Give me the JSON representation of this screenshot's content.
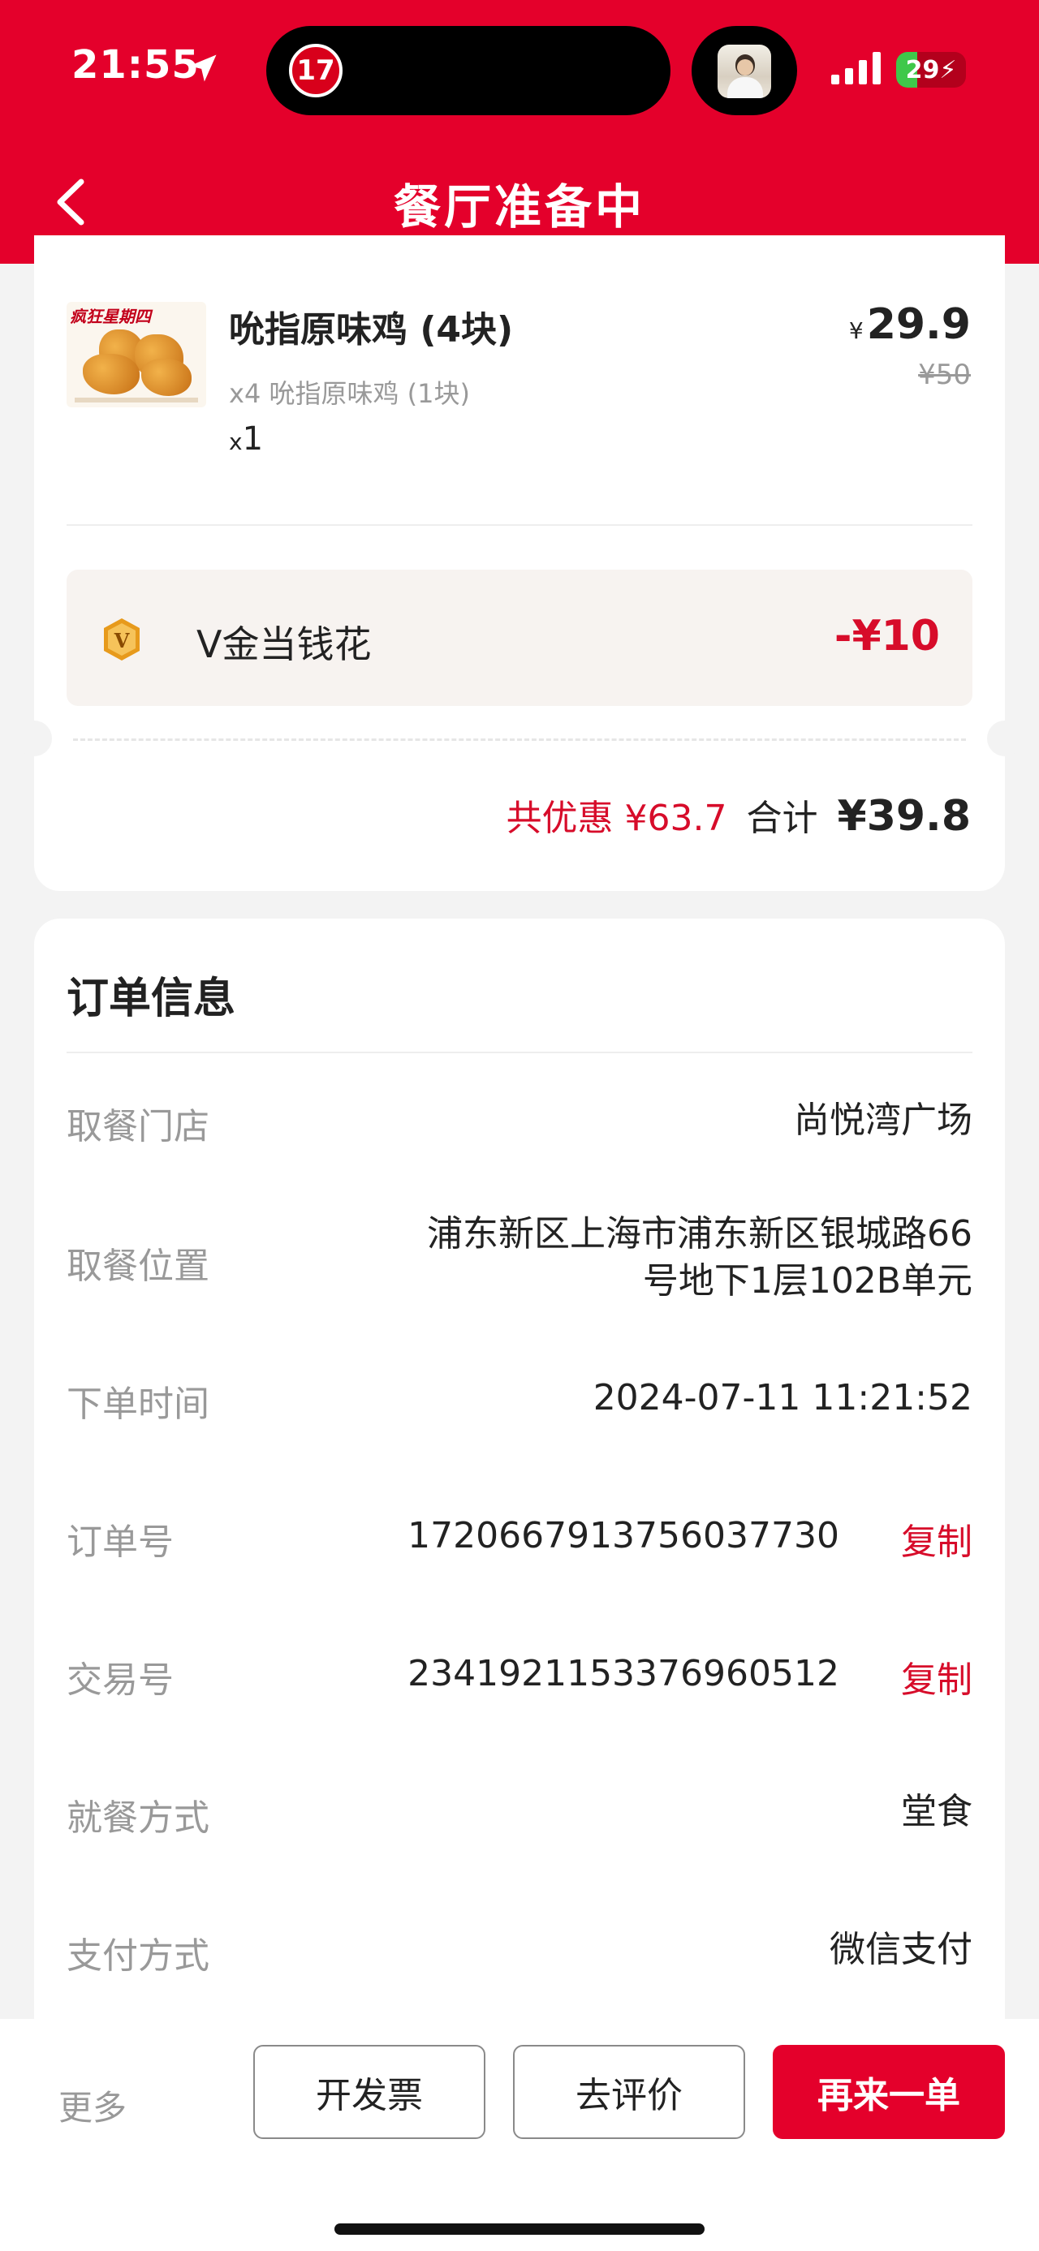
{
  "status_bar": {
    "time": "21:55",
    "timer_badge": "17",
    "battery": "29"
  },
  "nav": {
    "title": "餐厅准备中"
  },
  "product": {
    "name": "吮指原味鸡 (4块)",
    "sub": "x4 吮指原味鸡 (1块)",
    "qty_prefix": "x",
    "qty": "1",
    "currency": "¥",
    "price": "29.9",
    "original_price": "¥50",
    "image_tag": "疯狂星期四"
  },
  "vgold": {
    "label": "V金当钱花",
    "amount": "-¥10"
  },
  "totals": {
    "discount": "共优惠 ¥63.7",
    "sum_label": "合计",
    "sum": "¥39.8"
  },
  "order_info": {
    "title": "订单信息",
    "rows": [
      {
        "label": "取餐门店",
        "value": "尚悦湾广场"
      },
      {
        "label": "取餐位置",
        "value_line1": "浦东新区上海市浦东新区银城路66",
        "value_line2": "号地下1层102B单元"
      },
      {
        "label": "下单时间",
        "value": "2024-07-11 11:21:52"
      },
      {
        "label": "订单号",
        "value": "1720667913756037730",
        "action": "复制"
      },
      {
        "label": "交易号",
        "value": "2341921153376960512",
        "action": "复制"
      },
      {
        "label": "就餐方式",
        "value": "堂食"
      },
      {
        "label": "支付方式",
        "value": "微信支付"
      }
    ]
  },
  "bottom_bar": {
    "more": "更多",
    "invoice": "开发票",
    "review": "去评价",
    "reorder": "再来一单"
  },
  "colors": {
    "brand_red": "#e4002b",
    "accent_red": "#d70c2a"
  }
}
